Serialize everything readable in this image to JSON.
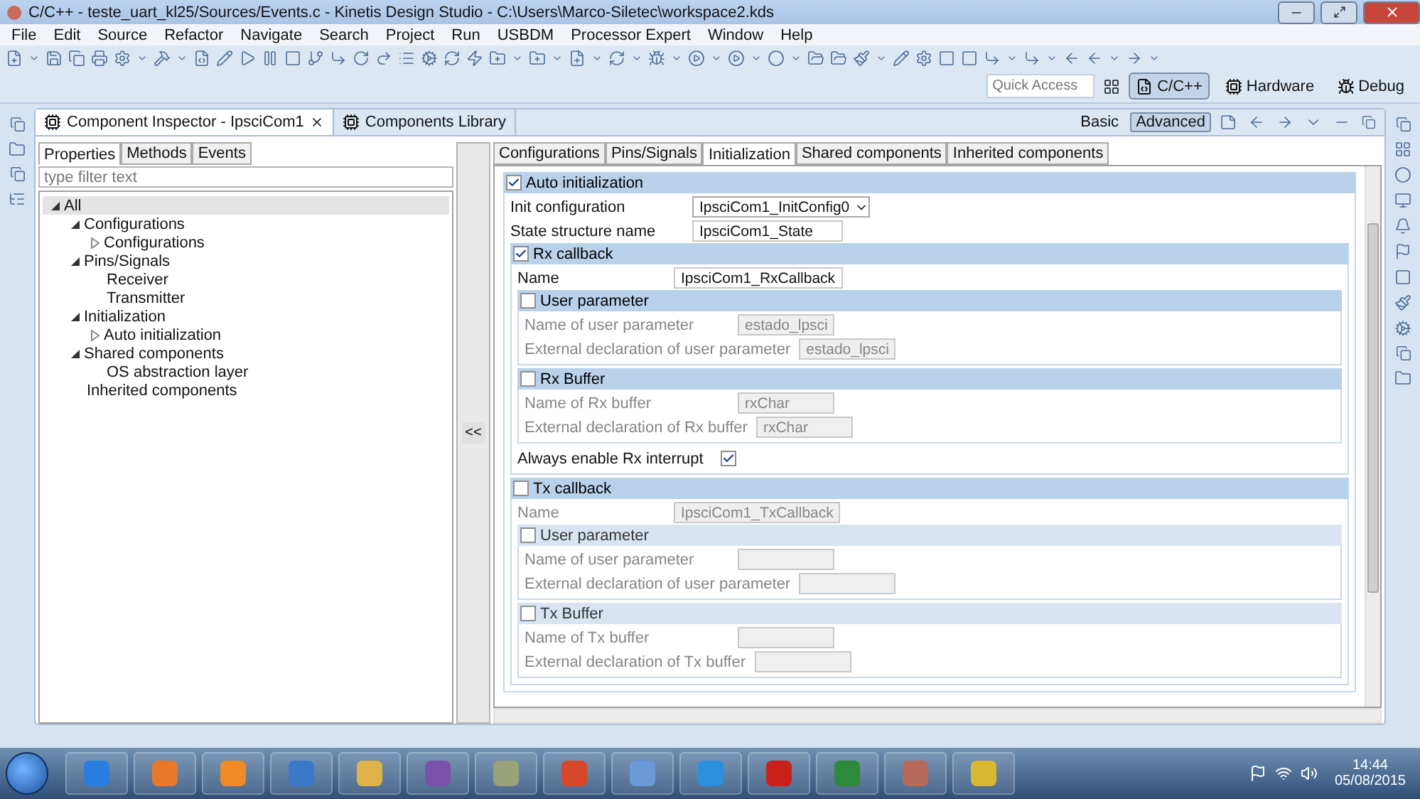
{
  "window": {
    "title": "C/C++ - teste_uart_kl25/Sources/Events.c - Kinetis Design Studio - C:\\Users\\Marco-Siletec\\workspace2.kds"
  },
  "menu": [
    "File",
    "Edit",
    "Source",
    "Refactor",
    "Navigate",
    "Search",
    "Project",
    "Run",
    "USBDM",
    "Processor Expert",
    "Window",
    "Help"
  ],
  "quick_access": {
    "placeholder": "Quick Access"
  },
  "perspectives": [
    {
      "label": "C/C++",
      "selected": true
    },
    {
      "label": "Hardware",
      "selected": false
    },
    {
      "label": "Debug",
      "selected": false
    }
  ],
  "view_tabs": [
    {
      "label": "Component Inspector - IpsciCom1",
      "selected": true
    },
    {
      "label": "Components Library",
      "selected": false
    }
  ],
  "modes": [
    {
      "label": "Basic",
      "selected": false
    },
    {
      "label": "Advanced",
      "selected": true
    }
  ],
  "inspector_tabs": [
    {
      "label": "Properties",
      "selected": true
    },
    {
      "label": "Methods",
      "selected": false
    },
    {
      "label": "Events",
      "selected": false
    }
  ],
  "filter": {
    "placeholder": "type filter text"
  },
  "tree": [
    {
      "label": "All",
      "kind": "branch",
      "expanded": true,
      "selected": true,
      "children": [
        {
          "label": "Configurations",
          "kind": "branch",
          "expanded": true,
          "selected": false,
          "children": [
            {
              "label": "Configurations",
              "kind": "branch",
              "expanded": false,
              "selected": false
            }
          ]
        },
        {
          "label": "Pins/Signals",
          "kind": "branch",
          "expanded": true,
          "selected": false,
          "children": [
            {
              "label": "Receiver",
              "kind": "leaf",
              "selected": false
            },
            {
              "label": "Transmitter",
              "kind": "leaf",
              "selected": false
            }
          ]
        },
        {
          "label": "Initialization",
          "kind": "branch",
          "expanded": true,
          "selected": false,
          "children": [
            {
              "label": "Auto initialization",
              "kind": "branch",
              "expanded": false,
              "selected": false
            }
          ]
        },
        {
          "label": "Shared components",
          "kind": "branch",
          "expanded": true,
          "selected": false,
          "children": [
            {
              "label": "OS abstraction layer",
              "kind": "leaf",
              "selected": false
            }
          ]
        },
        {
          "label": "Inherited components",
          "kind": "leaf",
          "selected": false
        }
      ]
    }
  ],
  "collapse_button": {
    "label": "<<"
  },
  "config_tabs": [
    {
      "label": "Configurations",
      "selected": false
    },
    {
      "label": "Pins/Signals",
      "selected": false
    },
    {
      "label": "Initialization",
      "selected": true
    },
    {
      "label": "Shared components",
      "selected": false
    },
    {
      "label": "Inherited components",
      "selected": false
    }
  ],
  "form": [
    {
      "kind": "group",
      "label": "Auto initialization",
      "checked": true,
      "disabled": false,
      "items": [
        {
          "kind": "combo",
          "label": "Init configuration",
          "value": "IpsciCom1_InitConfig0",
          "disabled": false
        },
        {
          "kind": "field",
          "label": "State structure name",
          "value": "IpsciCom1_State",
          "disabled": false
        },
        {
          "kind": "group",
          "label": "Rx callback",
          "checked": true,
          "disabled": false,
          "items": [
            {
              "kind": "field",
              "label": "Name",
              "value": "IpsciCom1_RxCallback",
              "disabled": false
            },
            {
              "kind": "group",
              "label": "User parameter",
              "checked": false,
              "disabled": false,
              "items": [
                {
                  "kind": "field",
                  "label": "Name of user parameter",
                  "value": "estado_lpsci",
                  "disabled": true
                },
                {
                  "kind": "field",
                  "label": "External declaration of user parameter",
                  "value": "estado_lpsci",
                  "disabled": true
                }
              ]
            },
            {
              "kind": "group",
              "label": "Rx Buffer",
              "checked": false,
              "disabled": false,
              "items": [
                {
                  "kind": "field",
                  "label": "Name of Rx buffer",
                  "value": "rxChar",
                  "disabled": true
                },
                {
                  "kind": "field",
                  "label": "External declaration of Rx buffer",
                  "value": "rxChar",
                  "disabled": true
                }
              ]
            },
            {
              "kind": "check",
              "label": "Always enable Rx interrupt",
              "checked": true
            }
          ]
        },
        {
          "kind": "group",
          "label": "Tx callback",
          "checked": false,
          "disabled": false,
          "items": [
            {
              "kind": "field",
              "label": "Name",
              "value": "IpsciCom1_TxCallback",
              "disabled": true
            },
            {
              "kind": "group",
              "label": "User parameter",
              "checked": false,
              "disabled": true,
              "items": [
                {
                  "kind": "field",
                  "label": "Name of user parameter",
                  "disabled": true
                },
                {
                  "kind": "field",
                  "label": "External declaration of user parameter",
                  "disabled": true
                }
              ]
            },
            {
              "kind": "group",
              "label": "Tx Buffer",
              "checked": false,
              "disabled": true,
              "items": [
                {
                  "kind": "field",
                  "label": "Name of Tx buffer",
                  "disabled": true
                },
                {
                  "kind": "field",
                  "label": "External declaration of Tx buffer",
                  "disabled": true
                }
              ]
            }
          ]
        }
      ]
    }
  ],
  "clock": {
    "time": "14:44",
    "date": "05/08/2015"
  }
}
